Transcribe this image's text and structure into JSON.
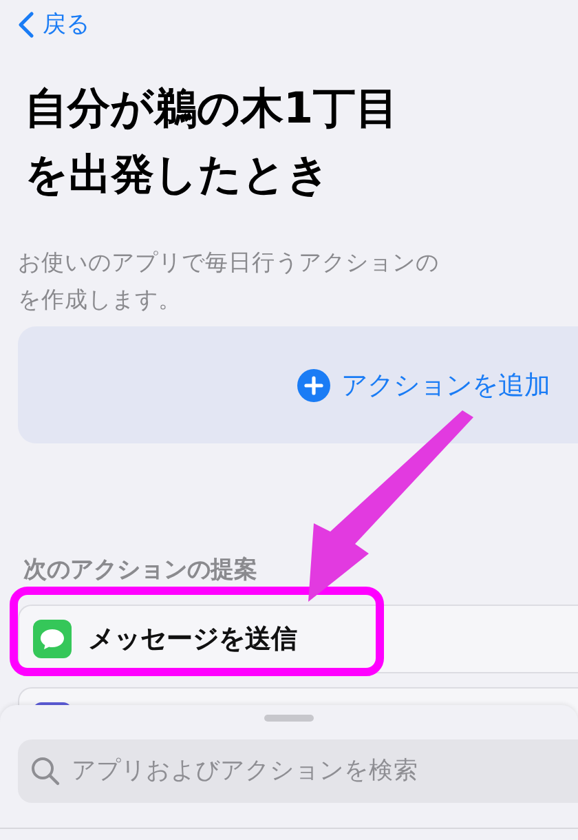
{
  "nav": {
    "back_label": "戻る"
  },
  "title_lines": [
    "自分が鵜の木1丁目",
    "を出発したとき"
  ],
  "description_lines": [
    "お使いのアプリで毎日行うアクションの",
    "を作成します。"
  ],
  "add_action": {
    "label": "アクションを追加"
  },
  "suggestions": {
    "header": "次のアクションの提案",
    "items": [
      {
        "label": "メッセージを送信",
        "kind": "messages"
      },
      {
        "kind": "apps"
      }
    ]
  },
  "search": {
    "placeholder": "アプリおよびアクションを検索"
  }
}
